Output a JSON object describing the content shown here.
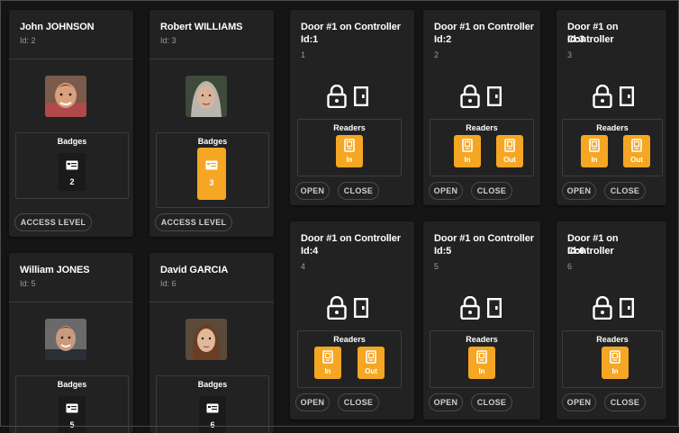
{
  "users": [
    {
      "name": "John JOHNSON",
      "id_label": "Id: 2",
      "badges_title": "Badges",
      "badge_count": "2",
      "badge_style": "dark",
      "access_label": "ACCESS LEVEL"
    },
    {
      "name": "Robert WILLIAMS",
      "id_label": "Id: 3",
      "badges_title": "Badges",
      "badge_count": "3",
      "badge_style": "orange",
      "access_label": "ACCESS LEVEL"
    },
    {
      "name": "William JONES",
      "id_label": "Id: 5",
      "badges_title": "Badges",
      "badge_count": "5",
      "badge_style": "dark"
    },
    {
      "name": "David GARCIA",
      "id_label": "Id: 6",
      "badges_title": "Badges",
      "badge_count": "6",
      "badge_style": "dark"
    }
  ],
  "doors": [
    {
      "title_line1": "Door #1 on Controller",
      "title_line2": "Id:1",
      "number": "1",
      "readers_title": "Readers",
      "readers": [
        "In"
      ],
      "open_label": "OPEN",
      "close_label": "CLOSE"
    },
    {
      "title_line1": "Door #1 on Controller",
      "title_line2": "Id:2",
      "number": "2",
      "readers_title": "Readers",
      "readers": [
        "In",
        "Out"
      ],
      "open_label": "OPEN",
      "close_label": "CLOSE"
    },
    {
      "title_line1": "Door #1 on Controller",
      "title_line2": "Id:3",
      "number": "3",
      "readers_title": "Readers",
      "readers": [
        "In",
        "Out"
      ],
      "open_label": "OPEN",
      "close_label": "CLOSE"
    },
    {
      "title_line1": "Door #1 on Controller",
      "title_line2": "Id:4",
      "number": "4",
      "readers_title": "Readers",
      "readers": [
        "In",
        "Out"
      ],
      "open_label": "OPEN",
      "close_label": "CLOSE"
    },
    {
      "title_line1": "Door #1 on Controller",
      "title_line2": "Id:5",
      "number": "5",
      "readers_title": "Readers",
      "readers": [
        "In"
      ],
      "open_label": "OPEN",
      "close_label": "CLOSE"
    },
    {
      "title_line1": "Door #1 on Controller",
      "title_line2": "Id:6",
      "number": "6",
      "readers_title": "Readers",
      "readers": [
        "In"
      ],
      "open_label": "OPEN",
      "close_label": "CLOSE"
    }
  ],
  "icons": {
    "lock": "lock-icon",
    "door": "door-icon",
    "badge": "id-card-icon",
    "reader": "card-reader-icon"
  },
  "colors": {
    "accent": "#f5a623",
    "card": "#222222",
    "background": "#151515"
  }
}
